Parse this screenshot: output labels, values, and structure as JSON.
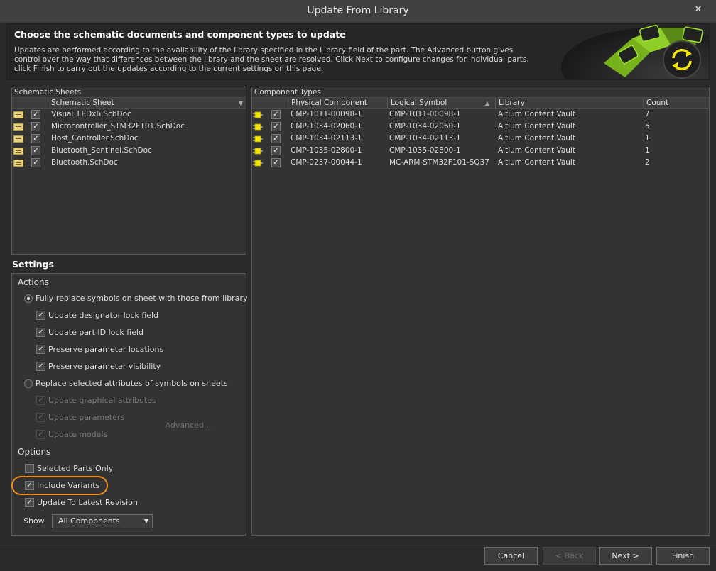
{
  "window": {
    "title": "Update From Library",
    "close_glyph": "✕"
  },
  "header": {
    "heading": "Choose the schematic documents and component types to update",
    "description": "Updates are performed according to the availability of the library specified in the Library field of the part. The Advanced button gives control over the way that differences between the library and the sheet are resolved. Click Next to configure changes for individual parts, click Finish to carry out the updates according to the current settings on this page."
  },
  "schematic_sheets": {
    "panel_title": "Schematic Sheets",
    "column_header": "Schematic Sheet",
    "rows": [
      {
        "name": "Visual_LEDx6.SchDoc",
        "checked": true
      },
      {
        "name": "Microcontroller_STM32F101.SchDoc",
        "checked": true
      },
      {
        "name": "Host_Controller.SchDoc",
        "checked": true
      },
      {
        "name": "Bluetooth_Sentinel.SchDoc",
        "checked": true
      },
      {
        "name": "Bluetooth.SchDoc",
        "checked": true
      }
    ]
  },
  "component_types": {
    "panel_title": "Component Types",
    "columns": [
      "Physical Component",
      "Logical Symbol",
      "Library",
      "Count"
    ],
    "rows": [
      {
        "physical": "CMP-1011-00098-1",
        "logical": "CMP-1011-00098-1",
        "library": "Altium Content Vault",
        "count": "7"
      },
      {
        "physical": "CMP-1034-02060-1",
        "logical": "CMP-1034-02060-1",
        "library": "Altium Content Vault",
        "count": "5"
      },
      {
        "physical": "CMP-1034-02113-1",
        "logical": "CMP-1034-02113-1",
        "library": "Altium Content Vault",
        "count": "1"
      },
      {
        "physical": "CMP-1035-02800-1",
        "logical": "CMP-1035-02800-1",
        "library": "Altium Content Vault",
        "count": "1"
      },
      {
        "physical": "CMP-0237-00044-1",
        "logical": "MC-ARM-STM32F101-SQ37",
        "library": "Altium Content Vault",
        "count": "2"
      }
    ]
  },
  "settings": {
    "title": "Settings",
    "actions_label": "Actions",
    "radio_fully_replace": "Fully replace symbols on sheet with those from library",
    "fully_replace_options": [
      "Update designator lock field",
      "Update part ID lock field",
      "Preserve parameter locations",
      "Preserve parameter visibility"
    ],
    "radio_replace_selected": "Replace selected attributes of symbols on sheets",
    "replace_selected_options": [
      "Update graphical attributes",
      "Update parameters",
      "Update models"
    ],
    "advanced_button": "Advanced...",
    "options_label": "Options",
    "selected_parts_only": "Selected Parts Only",
    "include_variants": "Include Variants",
    "update_latest_revision": "Update To Latest Revision",
    "show_label": "Show",
    "show_value": "All Components"
  },
  "footer": {
    "cancel": "Cancel",
    "back": "< Back",
    "next": "Next >",
    "finish": "Finish"
  },
  "colors": {
    "highlight": "#f08c1e",
    "accent_green": "#8fd11e",
    "accent_yellow": "#f2e600"
  },
  "icons": [
    "close-icon",
    "sheet-icon",
    "component-icon",
    "checkbox-check-icon",
    "sort-arrow-icon",
    "dropdown-arrow-icon",
    "sync-icon"
  ]
}
